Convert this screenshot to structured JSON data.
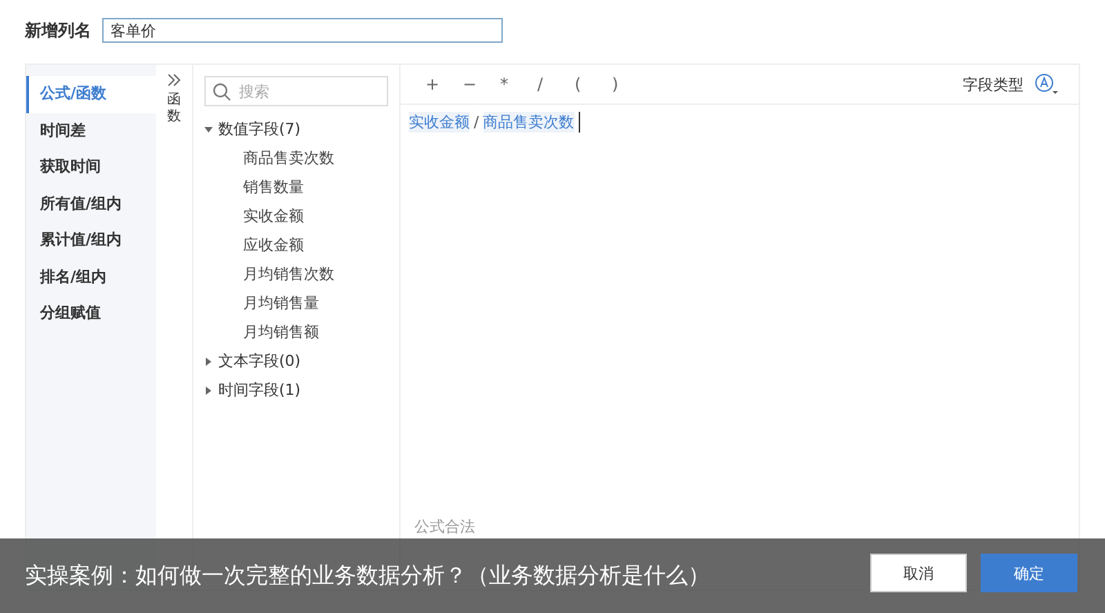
{
  "header": {
    "label": "新增列名",
    "name_field": {
      "value": "客单价"
    }
  },
  "categories": [
    {
      "label": "公式/函数",
      "selected": true
    },
    {
      "label": "时间差",
      "selected": false
    },
    {
      "label": "获取时间",
      "selected": false
    },
    {
      "label": "所有值/组内",
      "selected": false
    },
    {
      "label": "累计值/组内",
      "selected": false
    },
    {
      "label": "排名/组内",
      "selected": false
    },
    {
      "label": "分组赋值",
      "selected": false
    }
  ],
  "collapse_panel": {
    "label": "函数"
  },
  "search": {
    "placeholder": "搜索"
  },
  "field_groups": [
    {
      "label": "数值字段(7)",
      "expanded": true,
      "children": [
        {
          "label": "商品售卖次数"
        },
        {
          "label": "销售数量"
        },
        {
          "label": "实收金额"
        },
        {
          "label": "应收金额"
        },
        {
          "label": "月均销售次数"
        },
        {
          "label": "月均销售量"
        },
        {
          "label": "月均销售额"
        }
      ]
    },
    {
      "label": "文本字段(0)",
      "expanded": false
    },
    {
      "label": "时间字段(1)",
      "expanded": false
    }
  ],
  "operators": [
    "+",
    "−",
    "*",
    "/",
    "(",
    ")"
  ],
  "field_type": {
    "label": "字段类型"
  },
  "formula": [
    {
      "kind": "field",
      "text": "实收金额"
    },
    {
      "kind": "operator",
      "text": "/"
    },
    {
      "kind": "field",
      "text": "商品售卖次数"
    }
  ],
  "status": "公式合法",
  "buttons": [
    {
      "label": "取消",
      "kind": "secondary"
    },
    {
      "label": "确定",
      "kind": "primary"
    }
  ],
  "caption": "实操案例：如何做一次完整的业务数据分析？（业务数据分析是什么）"
}
